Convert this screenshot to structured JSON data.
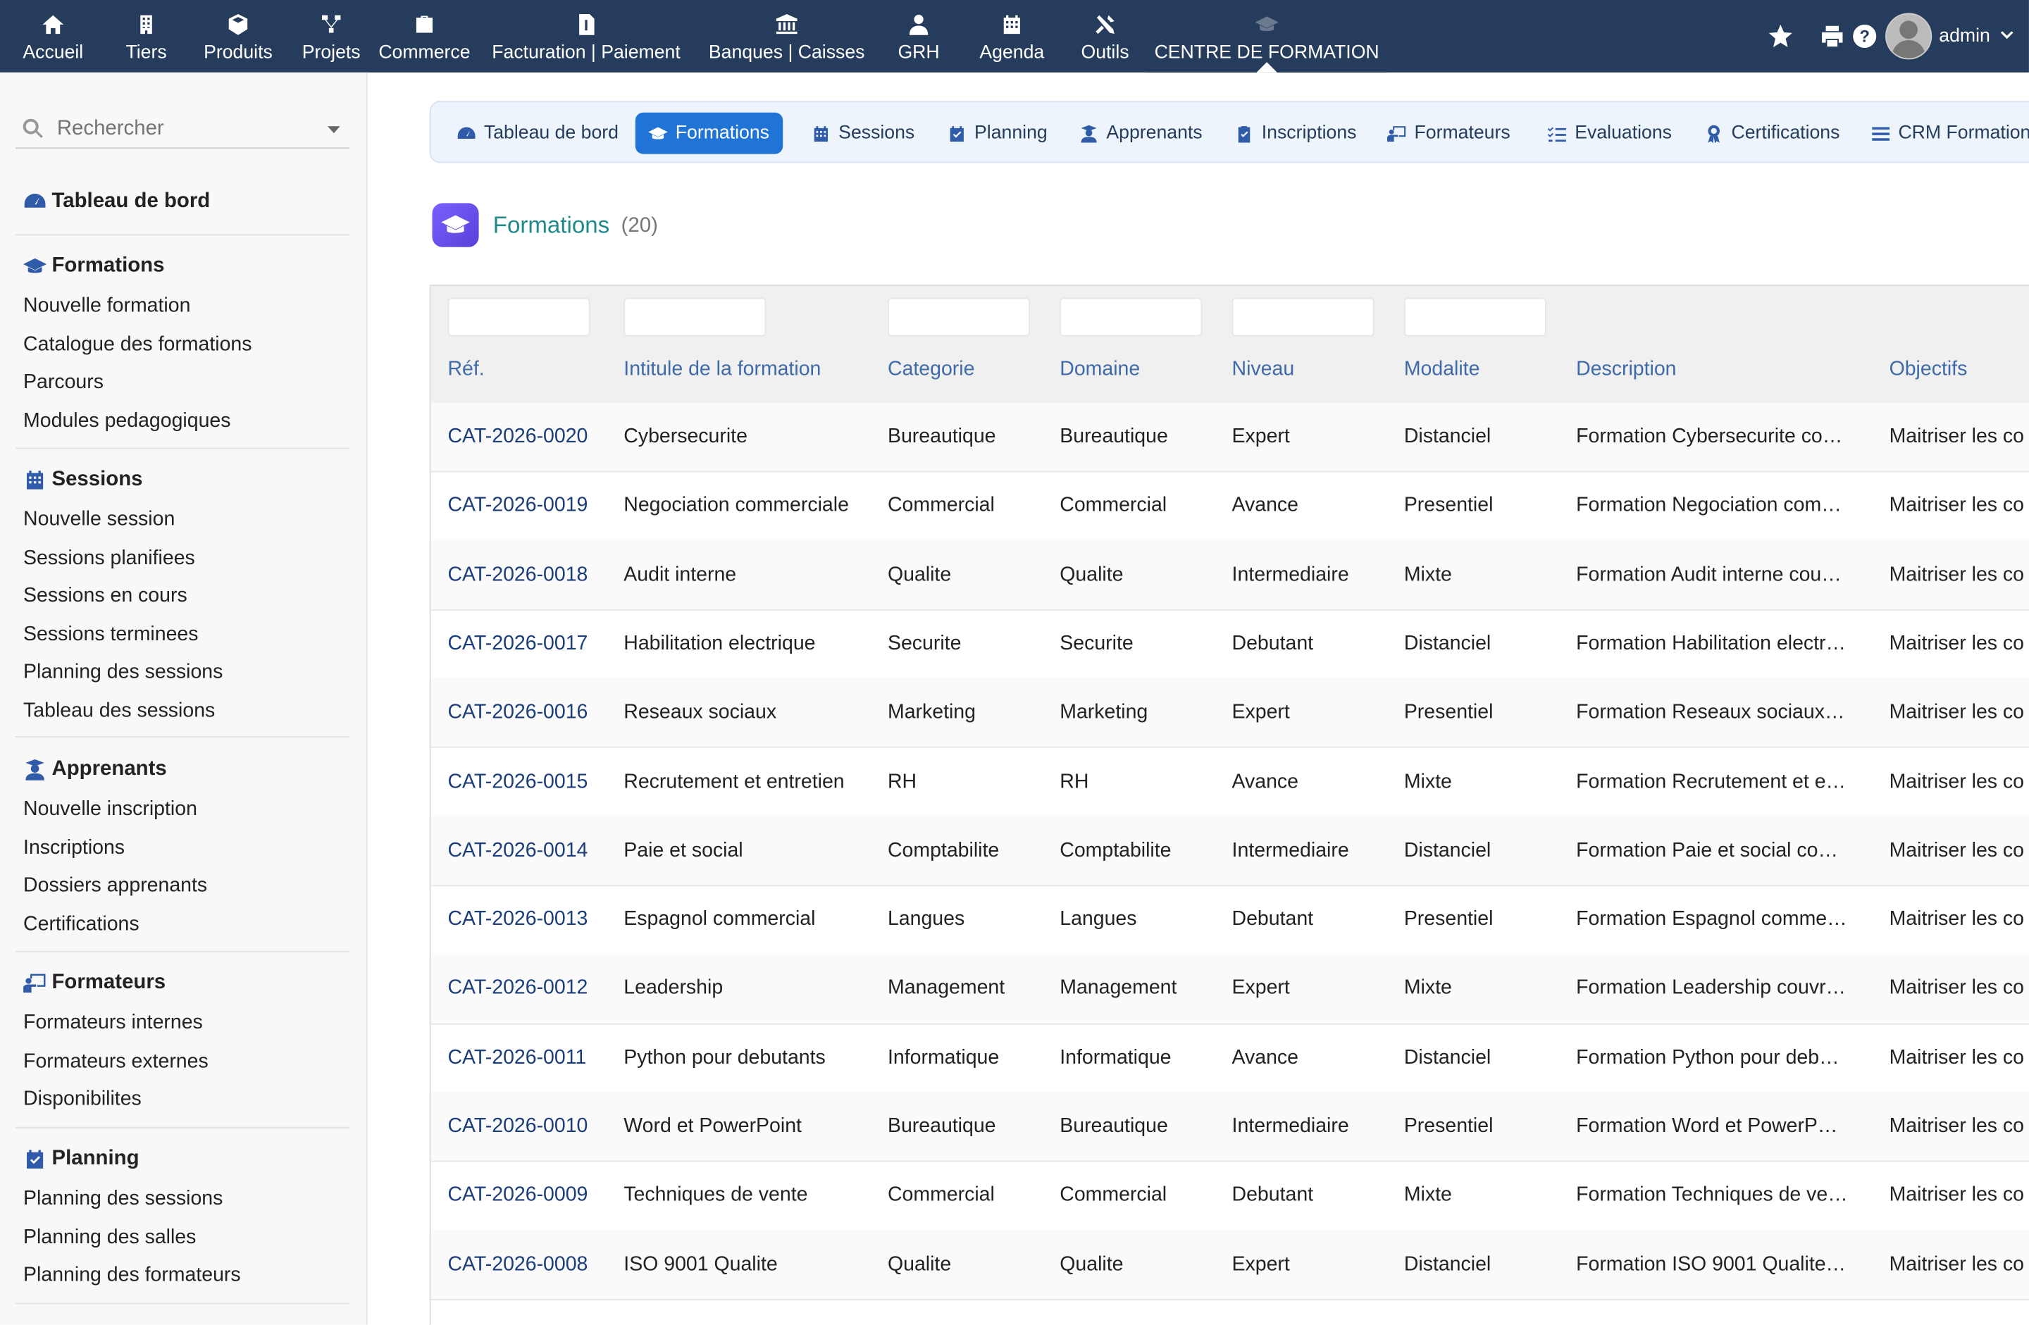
{
  "topnav": {
    "items": [
      {
        "label": "Accueil",
        "icon": "home-icon"
      },
      {
        "label": "Tiers",
        "icon": "building-icon"
      },
      {
        "label": "Produits",
        "icon": "cube-icon"
      },
      {
        "label": "Projets",
        "icon": "sitemap-icon"
      },
      {
        "label": "Commerce",
        "icon": "suitcase-icon"
      },
      {
        "label": "Facturation | Paiement",
        "icon": "invoice-icon"
      },
      {
        "label": "Banques | Caisses",
        "icon": "bank-icon"
      },
      {
        "label": "GRH",
        "icon": "user-tie-icon"
      },
      {
        "label": "Agenda",
        "icon": "calendar-icon"
      },
      {
        "label": "Outils",
        "icon": "tools-icon"
      },
      {
        "label": "CENTRE DE FORMATION",
        "icon": "graduation-cap-icon"
      }
    ],
    "user": "admin"
  },
  "search": {
    "placeholder": "Rechercher"
  },
  "leftmenu": {
    "sections": [
      {
        "title": "Tableau de bord",
        "icon": "dashboard-icon",
        "links": []
      },
      {
        "title": "Formations",
        "icon": "graduation-cap-icon",
        "links": [
          "Nouvelle formation",
          "Catalogue des formations",
          "Parcours",
          "Modules pedagogiques"
        ]
      },
      {
        "title": "Sessions",
        "icon": "calendar-icon",
        "links": [
          "Nouvelle session",
          "Sessions planifiees",
          "Sessions en cours",
          "Sessions terminees",
          "Planning des sessions",
          "Tableau des sessions"
        ]
      },
      {
        "title": "Apprenants",
        "icon": "user-graduate-icon",
        "links": [
          "Nouvelle inscription",
          "Inscriptions",
          "Dossiers apprenants",
          "Certifications"
        ]
      },
      {
        "title": "Formateurs",
        "icon": "chalkboard-teacher-icon",
        "links": [
          "Formateurs internes",
          "Formateurs externes",
          "Disponibilites"
        ]
      },
      {
        "title": "Planning",
        "icon": "calendar-check-icon",
        "links": [
          "Planning des sessions",
          "Planning des salles",
          "Planning des formateurs"
        ]
      }
    ]
  },
  "tabs": [
    {
      "label": "Tableau de bord",
      "icon": "dashboard-icon"
    },
    {
      "label": "Formations",
      "icon": "graduation-cap-icon",
      "active": true
    },
    {
      "label": "Sessions",
      "icon": "calendar-icon"
    },
    {
      "label": "Planning",
      "icon": "calendar-check-icon"
    },
    {
      "label": "Apprenants",
      "icon": "user-graduate-icon"
    },
    {
      "label": "Inscriptions",
      "icon": "clipboard-check-icon"
    },
    {
      "label": "Formateurs",
      "icon": "chalkboard-teacher-icon"
    },
    {
      "label": "Evaluations",
      "icon": "list-check-icon"
    },
    {
      "label": "Certifications",
      "icon": "award-icon"
    },
    {
      "label": "CRM Formation",
      "icon": "bars-icon"
    }
  ],
  "page": {
    "title": "Formations",
    "count": "(20)"
  },
  "table": {
    "columns": [
      "Réf.",
      "Intitule de la formation",
      "Categorie",
      "Domaine",
      "Niveau",
      "Modalite",
      "Description",
      "Objectifs"
    ],
    "rows": [
      [
        "CAT-2026-0020",
        "Cybersecurite",
        "Bureautique",
        "Bureautique",
        "Expert",
        "Distanciel",
        "Formation Cybersecurite co…",
        "Maitriser les co"
      ],
      [
        "CAT-2026-0019",
        "Negociation commerciale",
        "Commercial",
        "Commercial",
        "Avance",
        "Presentiel",
        "Formation Negociation com…",
        "Maitriser les co"
      ],
      [
        "CAT-2026-0018",
        "Audit interne",
        "Qualite",
        "Qualite",
        "Intermediaire",
        "Mixte",
        "Formation Audit interne cou…",
        "Maitriser les co"
      ],
      [
        "CAT-2026-0017",
        "Habilitation electrique",
        "Securite",
        "Securite",
        "Debutant",
        "Distanciel",
        "Formation Habilitation electr…",
        "Maitriser les co"
      ],
      [
        "CAT-2026-0016",
        "Reseaux sociaux",
        "Marketing",
        "Marketing",
        "Expert",
        "Presentiel",
        "Formation Reseaux sociaux…",
        "Maitriser les co"
      ],
      [
        "CAT-2026-0015",
        "Recrutement et entretien",
        "RH",
        "RH",
        "Avance",
        "Mixte",
        "Formation Recrutement et e…",
        "Maitriser les co"
      ],
      [
        "CAT-2026-0014",
        "Paie et social",
        "Comptabilite",
        "Comptabilite",
        "Intermediaire",
        "Distanciel",
        "Formation Paie et social co…",
        "Maitriser les co"
      ],
      [
        "CAT-2026-0013",
        "Espagnol commercial",
        "Langues",
        "Langues",
        "Debutant",
        "Presentiel",
        "Formation Espagnol comme…",
        "Maitriser les co"
      ],
      [
        "CAT-2026-0012",
        "Leadership",
        "Management",
        "Management",
        "Expert",
        "Mixte",
        "Formation Leadership couvr…",
        "Maitriser les co"
      ],
      [
        "CAT-2026-0011",
        "Python pour debutants",
        "Informatique",
        "Informatique",
        "Avance",
        "Distanciel",
        "Formation Python pour deb…",
        "Maitriser les co"
      ],
      [
        "CAT-2026-0010",
        "Word et PowerPoint",
        "Bureautique",
        "Bureautique",
        "Intermediaire",
        "Presentiel",
        "Formation Word et PowerP…",
        "Maitriser les co"
      ],
      [
        "CAT-2026-0009",
        "Techniques de vente",
        "Commercial",
        "Commercial",
        "Debutant",
        "Mixte",
        "Formation Techniques de ve…",
        "Maitriser les co"
      ],
      [
        "CAT-2026-0008",
        "ISO 9001 Qualite",
        "Qualite",
        "Qualite",
        "Expert",
        "Distanciel",
        "Formation ISO 9001 Qualite…",
        "Maitriser les co"
      ]
    ]
  },
  "colors": {
    "topbar": "#263c5c",
    "accent": "#1f74d6",
    "link": "#1b3d7a",
    "header_text": "#3f6aa8",
    "title": "#1f8a8a"
  }
}
